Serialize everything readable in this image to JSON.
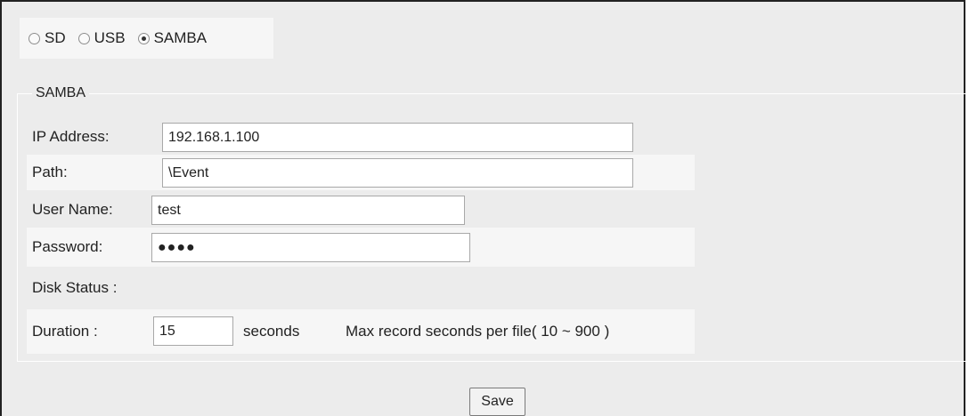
{
  "storage": {
    "options": [
      {
        "label": "SD",
        "checked": false
      },
      {
        "label": "USB",
        "checked": false
      },
      {
        "label": "SAMBA",
        "checked": true
      }
    ]
  },
  "samba": {
    "legend": "SAMBA",
    "ip": {
      "label": "IP Address:",
      "value": "192.168.1.100"
    },
    "path": {
      "label": "Path:",
      "value": "\\Event"
    },
    "user": {
      "label": "User Name:",
      "value": "test"
    },
    "password": {
      "label": "Password:",
      "value": "●●●●"
    },
    "disk_status": {
      "label": "Disk Status :"
    },
    "duration": {
      "label": "Duration :",
      "value": "15",
      "unit": "seconds",
      "hint": "Max record seconds per file( 10 ~ 900 )"
    }
  },
  "actions": {
    "save_label": "Save"
  }
}
